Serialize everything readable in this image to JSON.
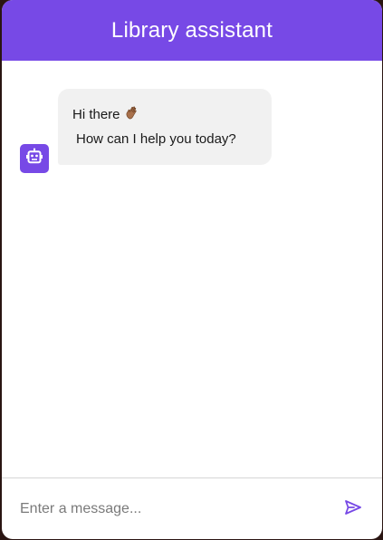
{
  "header": {
    "title": "Library assistant"
  },
  "messages": [
    {
      "sender": "bot",
      "line1": "Hi there",
      "emoji": "waving-hand-icon",
      "line2": "How can I help you today?"
    }
  ],
  "composer": {
    "placeholder": "Enter a message..."
  },
  "colors": {
    "accent": "#7749e6",
    "bubble": "#f1f1f1",
    "background": "#ffffff"
  },
  "icons": {
    "avatar": "robot-icon",
    "send": "send-icon"
  }
}
